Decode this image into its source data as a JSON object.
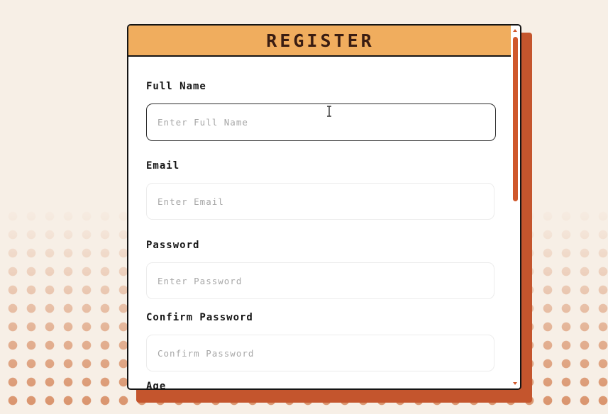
{
  "form": {
    "title": "REGISTER",
    "fields": [
      {
        "label": "Full Name",
        "placeholder": "Enter Full Name",
        "value": ""
      },
      {
        "label": "Email",
        "placeholder": "Enter Email",
        "value": ""
      },
      {
        "label": "Password",
        "placeholder": "Enter Password",
        "value": ""
      },
      {
        "label": "Confirm Password",
        "placeholder": "Confirm Password",
        "value": ""
      },
      {
        "label": "Age"
      }
    ]
  },
  "icons": {
    "cursor": "text-cursor-icon",
    "scroll_up": "scroll-up-arrow-icon",
    "scroll_down": "scroll-down-arrow-icon"
  },
  "colors": {
    "header": "#f0ad5e",
    "accent": "#d0582c",
    "shadow": "#c4552d",
    "background": "#f7efe6",
    "dots": "#d6885c",
    "border": "#141414"
  }
}
